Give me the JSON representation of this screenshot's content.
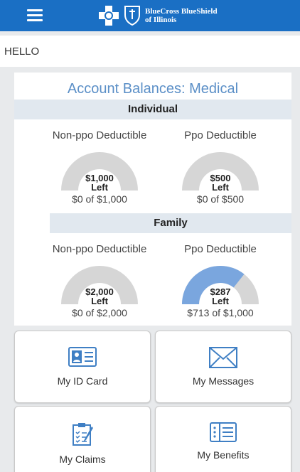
{
  "header": {
    "brand_line1": "BlueCross BlueShield",
    "brand_line2": "of Illinois"
  },
  "greeting": "HELLO",
  "balances": {
    "title": "Account Balances: Medical",
    "individual": {
      "heading": "Individual",
      "non_ppo": {
        "label": "Non-ppo Deductible",
        "center_value": "$1,000",
        "center_suffix": "Left",
        "amount": "$0 of $1,000",
        "used_fraction": 0
      },
      "ppo": {
        "label": "Ppo Deductible",
        "center_value": "$500",
        "center_suffix": "Left",
        "amount": "$0 of $500",
        "used_fraction": 0
      }
    },
    "family": {
      "heading": "Family",
      "non_ppo": {
        "label": "Non-ppo Deductible",
        "center_value": "$2,000",
        "center_suffix": "Left",
        "amount": "$0 of $2,000",
        "used_fraction": 0
      },
      "ppo": {
        "label": "Ppo Deductible",
        "center_value": "$287",
        "center_suffix": "Left",
        "amount": "$713 of $1,000",
        "used_fraction": 0.713
      }
    },
    "colors": {
      "track": "#d6d6d6",
      "fill": "#7aa6de"
    }
  },
  "tiles": {
    "id_card": {
      "label": "My ID Card",
      "icon": "id-card-icon"
    },
    "messages": {
      "label": "My Messages",
      "icon": "envelope-icon"
    },
    "claims": {
      "label": "My Claims",
      "icon": "clipboard-icon"
    },
    "benefits": {
      "label": "My Benefits",
      "icon": "list-icon"
    }
  },
  "colors": {
    "brand": "#1a6fc4",
    "title": "#5b8fc7",
    "icon": "#3f7fc4"
  }
}
